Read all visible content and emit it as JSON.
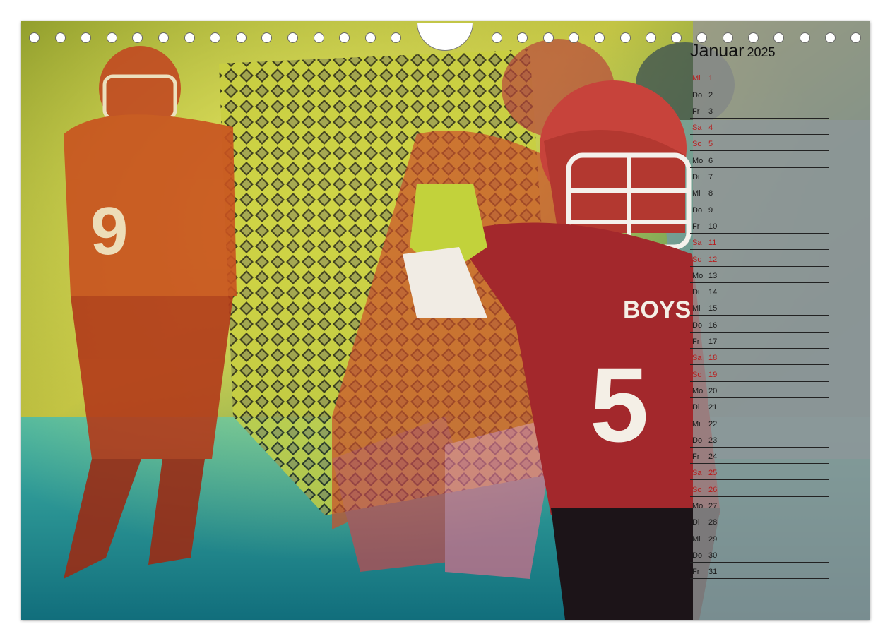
{
  "month": {
    "name": "Januar",
    "year": "2025"
  },
  "days": [
    {
      "dow": "Mi",
      "day": "1",
      "weekend": true
    },
    {
      "dow": "Do",
      "day": "2",
      "weekend": false
    },
    {
      "dow": "Fr",
      "day": "3",
      "weekend": false
    },
    {
      "dow": "Sa",
      "day": "4",
      "weekend": true
    },
    {
      "dow": "So",
      "day": "5",
      "weekend": true
    },
    {
      "dow": "Mo",
      "day": "6",
      "weekend": false
    },
    {
      "dow": "Di",
      "day": "7",
      "weekend": false
    },
    {
      "dow": "Mi",
      "day": "8",
      "weekend": false
    },
    {
      "dow": "Do",
      "day": "9",
      "weekend": false
    },
    {
      "dow": "Fr",
      "day": "10",
      "weekend": false
    },
    {
      "dow": "Sa",
      "day": "11",
      "weekend": true
    },
    {
      "dow": "So",
      "day": "12",
      "weekend": true
    },
    {
      "dow": "Mo",
      "day": "13",
      "weekend": false
    },
    {
      "dow": "Di",
      "day": "14",
      "weekend": false
    },
    {
      "dow": "Mi",
      "day": "15",
      "weekend": false
    },
    {
      "dow": "Do",
      "day": "16",
      "weekend": false
    },
    {
      "dow": "Fr",
      "day": "17",
      "weekend": false
    },
    {
      "dow": "Sa",
      "day": "18",
      "weekend": true
    },
    {
      "dow": "So",
      "day": "19",
      "weekend": true
    },
    {
      "dow": "Mo",
      "day": "20",
      "weekend": false
    },
    {
      "dow": "Di",
      "day": "21",
      "weekend": false
    },
    {
      "dow": "Mi",
      "day": "22",
      "weekend": false
    },
    {
      "dow": "Do",
      "day": "23",
      "weekend": false
    },
    {
      "dow": "Fr",
      "day": "24",
      "weekend": false
    },
    {
      "dow": "Sa",
      "day": "25",
      "weekend": true
    },
    {
      "dow": "So",
      "day": "26",
      "weekend": true
    },
    {
      "dow": "Mo",
      "day": "27",
      "weekend": false
    },
    {
      "dow": "Di",
      "day": "28",
      "weekend": false
    },
    {
      "dow": "Mi",
      "day": "29",
      "weekend": false
    },
    {
      "dow": "Do",
      "day": "30",
      "weekend": false
    },
    {
      "dow": "Fr",
      "day": "31",
      "weekend": false
    }
  ],
  "photo": {
    "jersey_front_text": "BOYS",
    "jersey_front_number": "5",
    "jersey_left_number": "9",
    "colors": {
      "jersey": "#c0392b",
      "helmet": "#b8322a",
      "field": "#2aa7a8",
      "glow": "#d6e14a"
    }
  },
  "colors": {
    "weekend_text": "#b81d1d",
    "panel": "#969696"
  }
}
